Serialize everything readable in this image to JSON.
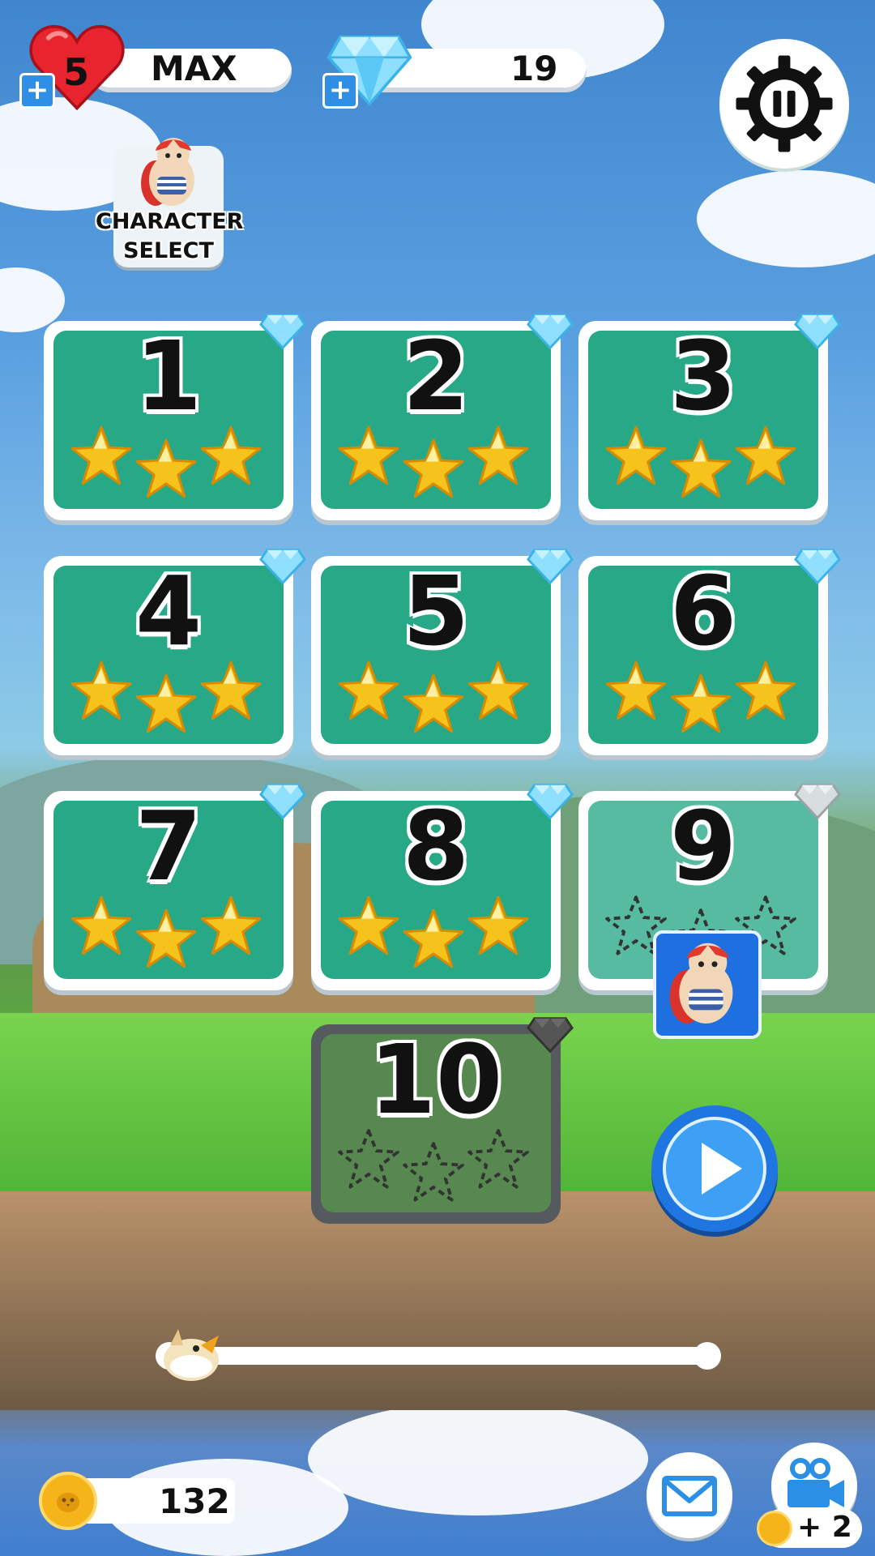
{
  "hud": {
    "lives_count": "5",
    "lives_status": "MAX",
    "diamonds": "19",
    "coins": "132",
    "character_select_label": "CHARACTER SELECT",
    "video_reward": "+ 2"
  },
  "levels": [
    {
      "number": "1",
      "stars": 3,
      "diamond": "collected",
      "state": "completed"
    },
    {
      "number": "2",
      "stars": 3,
      "diamond": "collected",
      "state": "completed"
    },
    {
      "number": "3",
      "stars": 3,
      "diamond": "collected",
      "state": "completed"
    },
    {
      "number": "4",
      "stars": 3,
      "diamond": "collected",
      "state": "completed"
    },
    {
      "number": "5",
      "stars": 3,
      "diamond": "collected",
      "state": "completed"
    },
    {
      "number": "6",
      "stars": 3,
      "diamond": "collected",
      "state": "completed"
    },
    {
      "number": "7",
      "stars": 3,
      "diamond": "collected",
      "state": "completed"
    },
    {
      "number": "8",
      "stars": 3,
      "diamond": "collected",
      "state": "completed"
    },
    {
      "number": "9",
      "stars": 0,
      "diamond": "empty",
      "state": "current"
    },
    {
      "number": "10",
      "stars": 0,
      "diamond": "locked",
      "state": "locked"
    }
  ],
  "progress": {
    "value": 0
  },
  "colors": {
    "tile_green": "#27a886",
    "star_gold": "#f6c21c",
    "diamond_blue": "#7fd6ff",
    "accent_blue": "#1f76e0",
    "heart_red": "#e8252f"
  },
  "icons": {
    "settings": "gear-icon",
    "pause": "pause-icon",
    "mail": "mail-icon",
    "video": "video-camera-icon",
    "play": "play-icon"
  }
}
